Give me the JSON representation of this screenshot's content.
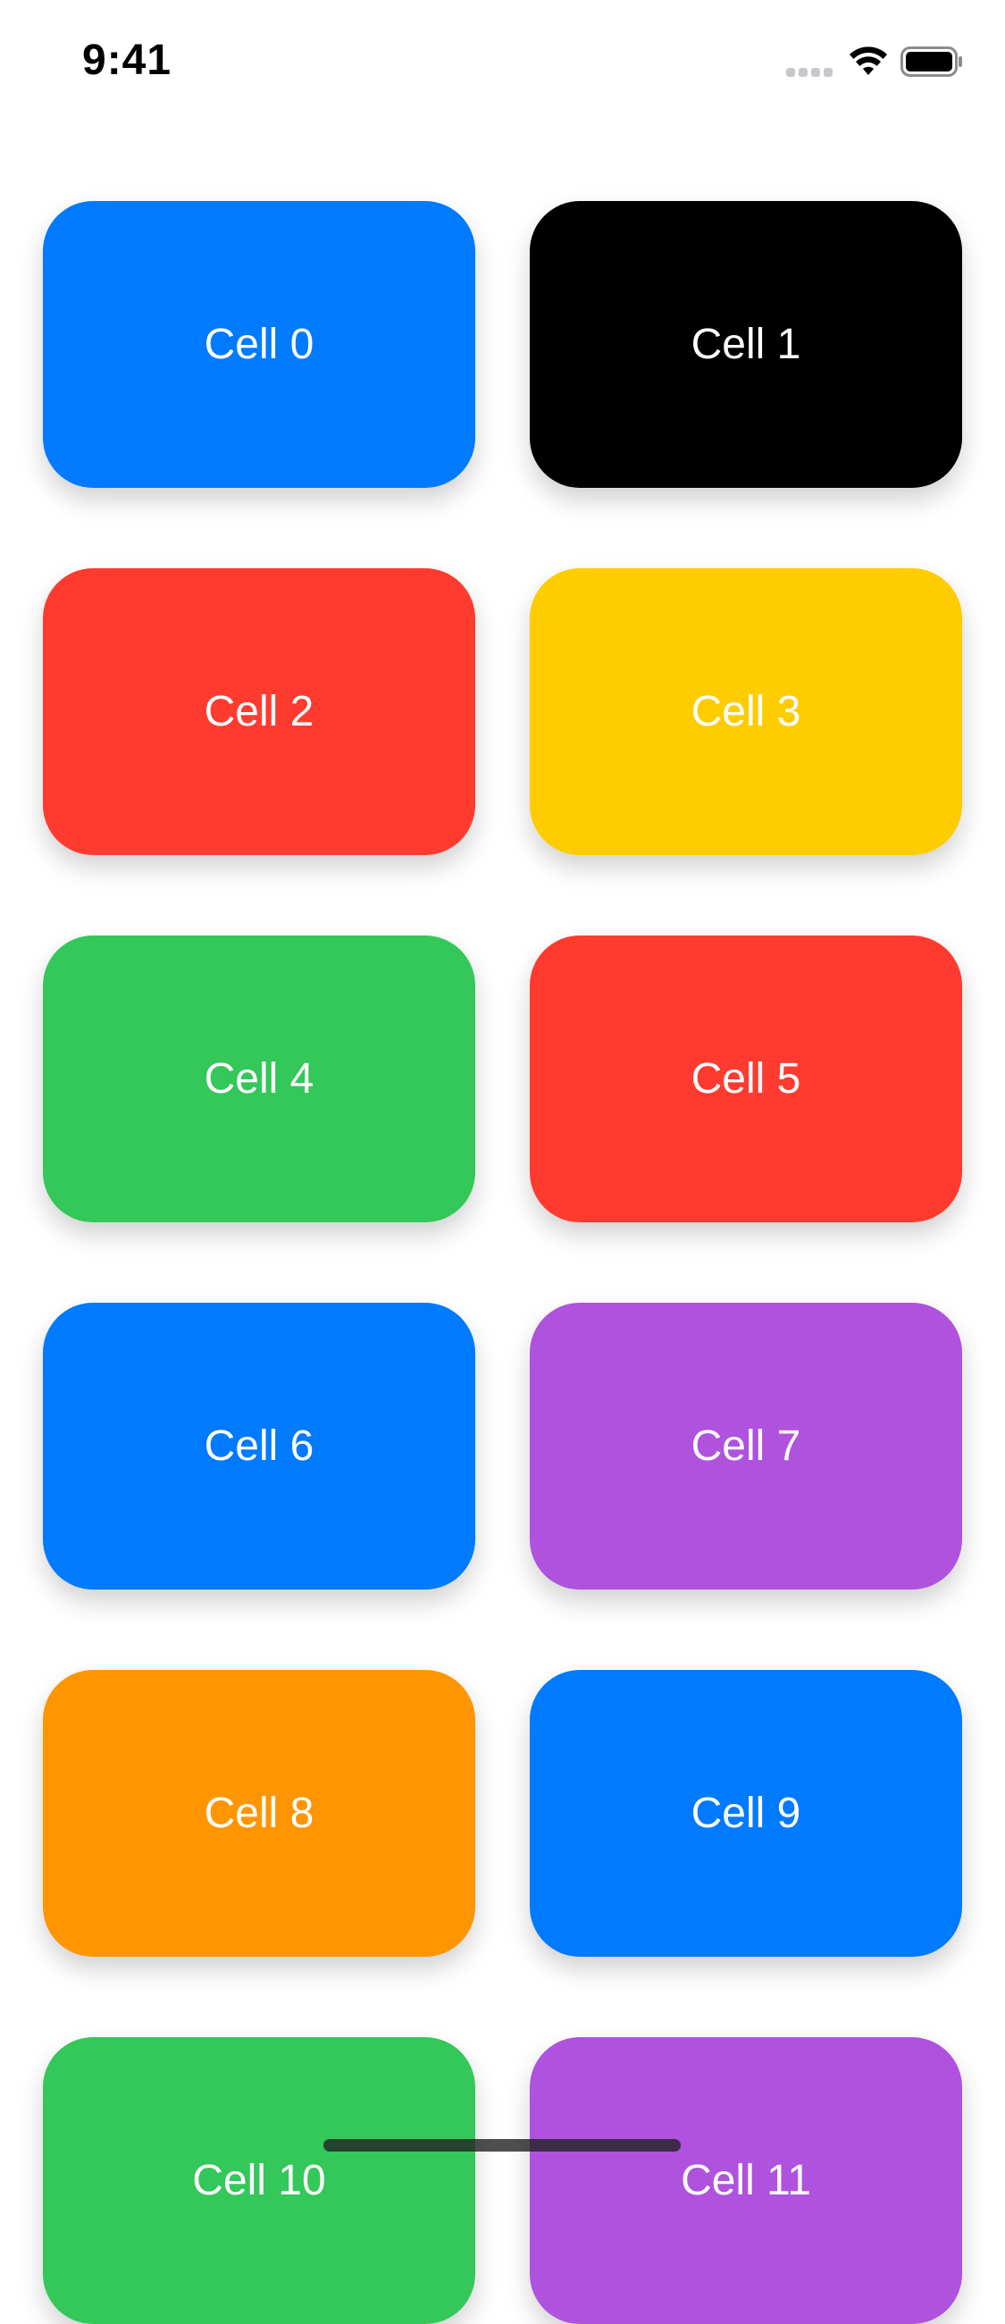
{
  "status_bar": {
    "time": "9:41",
    "icons": [
      "cellular-signal-icon",
      "wifi-icon",
      "battery-icon"
    ]
  },
  "grid": {
    "cells": [
      {
        "label": "Cell 0",
        "color": "#007AFF"
      },
      {
        "label": "Cell 1",
        "color": "#000000"
      },
      {
        "label": "Cell 2",
        "color": "#FF3B30"
      },
      {
        "label": "Cell 3",
        "color": "#FFCC00"
      },
      {
        "label": "Cell 4",
        "color": "#34C759"
      },
      {
        "label": "Cell 5",
        "color": "#FF3B30"
      },
      {
        "label": "Cell 6",
        "color": "#007AFF"
      },
      {
        "label": "Cell 7",
        "color": "#AF52DE"
      },
      {
        "label": "Cell 8",
        "color": "#FF9500"
      },
      {
        "label": "Cell 9",
        "color": "#007AFF"
      },
      {
        "label": "Cell 10",
        "color": "#34C759"
      },
      {
        "label": "Cell 11",
        "color": "#AF52DE"
      }
    ]
  }
}
